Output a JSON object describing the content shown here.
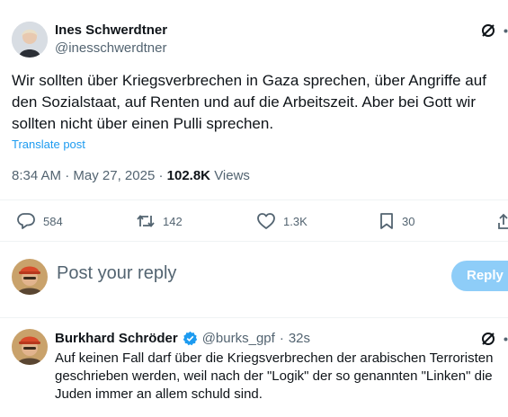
{
  "post": {
    "author_name": "Ines Schwerdtner",
    "author_handle": "@inesschwerdtner",
    "text_lines": [
      "Wir sollten über Kriegsverbrechen in Gaza sprechen, über Angriffe auf",
      "den Sozialstaat, auf Renten und auf die Arbeitszeit. Aber bei Gott wir",
      "sollten nicht über einen Pulli sprechen."
    ],
    "translate_label": "Translate post",
    "time": "8:34 AM",
    "sep1": "·",
    "date": "May 27, 2025",
    "sep2": "·",
    "views_count": "102.8K",
    "views_label": "Views",
    "stats": {
      "replies": "584",
      "reposts": "142",
      "likes": "1.3K",
      "bookmarks": "30"
    }
  },
  "reply_box": {
    "placeholder": "Post your reply",
    "button_label": "Reply"
  },
  "reply": {
    "author_name": "Burkhard Schröder",
    "author_handle": "@burks_gpf",
    "sep": "·",
    "time_ago": "32s",
    "text_lines": [
      "Auf keinen Fall darf über die Kriegsverbrechen der arabischen Terroristen",
      "geschrieben werden, weil nach der \"Logik\" der so genannten \"Linken\" die",
      "Juden immer an allem schuld sind."
    ]
  },
  "colors": {
    "link": "#1d9bf0",
    "verified": "#1d9bf0",
    "reply_button_bg": "#8ecdf8",
    "muted": "#536471"
  }
}
